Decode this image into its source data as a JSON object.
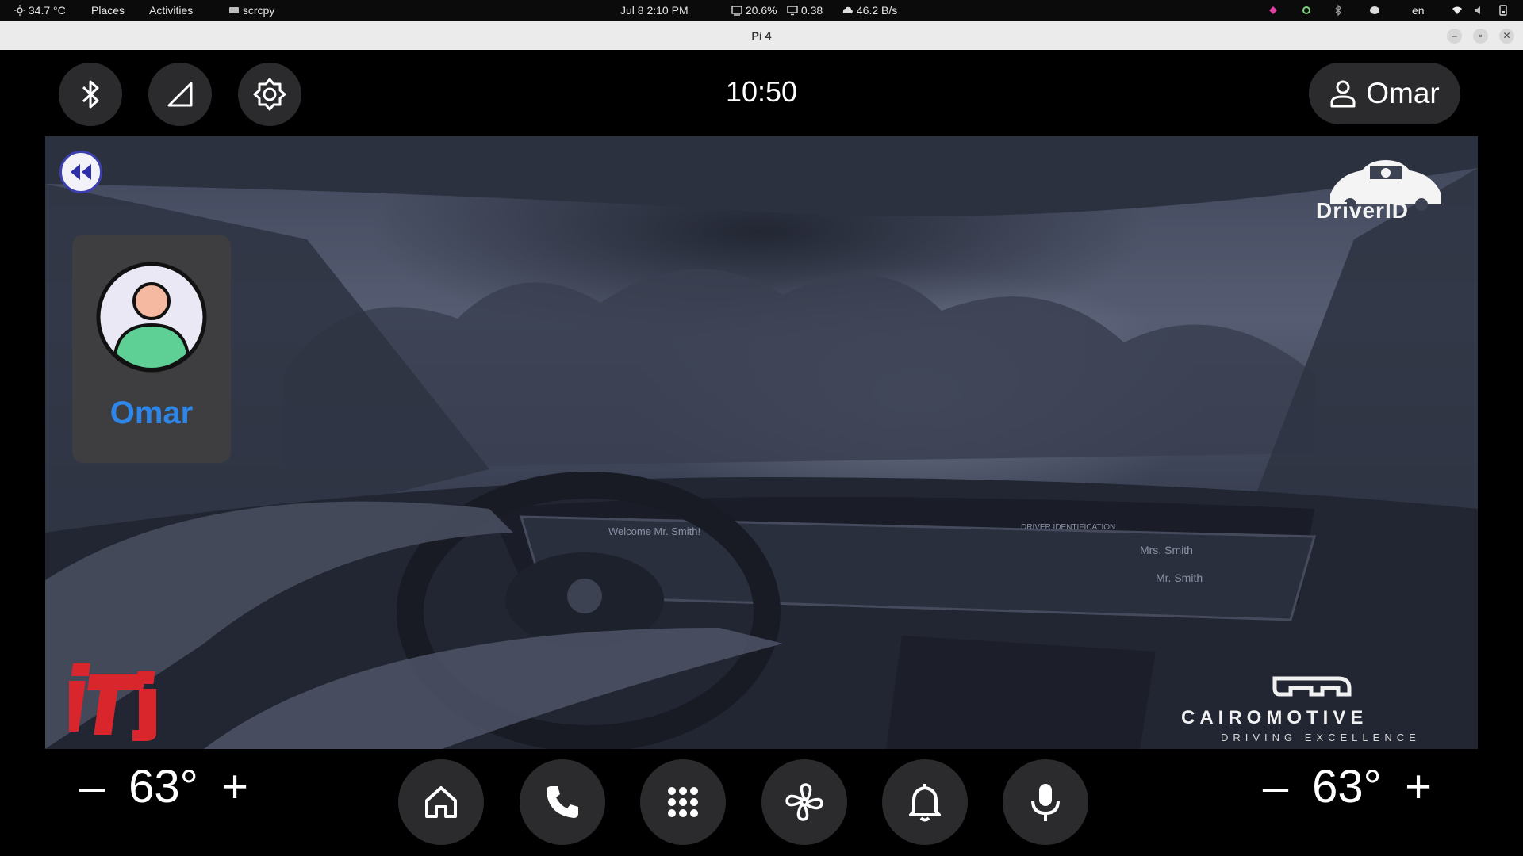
{
  "topbar": {
    "weather": "34.7 °C",
    "places": "Places",
    "activities": "Activities",
    "app_name": "scrcpy",
    "datetime": "Jul 8  2:10 PM",
    "cpu": "20.6%",
    "load": "0.38",
    "network": "46.2 B/s",
    "language": "en"
  },
  "window": {
    "title": "Pi 4"
  },
  "header": {
    "clock": "10:50",
    "user_name": "Omar"
  },
  "profile": {
    "name": "Omar",
    "name_color": "#2e86e8"
  },
  "branding": {
    "driverid": "DriverID",
    "iti": "iTi",
    "cairomotive": "CAIROMOTIVE",
    "cairomotive_tagline": "DRIVING EXCELLENCE"
  },
  "climate": {
    "left_temp": "63°",
    "right_temp": "63°",
    "minus": "–",
    "plus": "+"
  },
  "dock": {
    "icons": [
      "home-icon",
      "phone-icon",
      "apps-grid-icon",
      "fan-icon",
      "bell-icon",
      "microphone-icon"
    ]
  },
  "colors": {
    "accent_blue": "#2e86e8",
    "back_button_ring": "#3c3fb0",
    "iti_red": "#d8262c",
    "button_bg": "#2b2b2e"
  }
}
